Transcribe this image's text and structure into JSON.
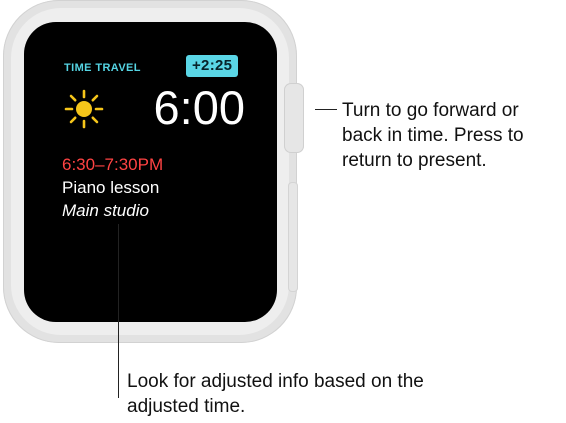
{
  "watch": {
    "mode_label": "TIME TRAVEL",
    "time_offset": "+2:25",
    "weather_icon": "sun-icon",
    "time": "6:00",
    "event": {
      "time_range": "6:30–7:30PM",
      "title": "Piano lesson",
      "location": "Main studio"
    }
  },
  "callouts": {
    "crown": "Turn to go forward or back in time. Press to return to present.",
    "adjusted_info": "Look for adjusted info based on the adjusted time."
  },
  "colors": {
    "accent_cyan": "#55d4e3",
    "event_red": "#ff4343",
    "sun_yellow": "#f5c51a",
    "screen": "#000000",
    "case": "#e2e2e2"
  }
}
